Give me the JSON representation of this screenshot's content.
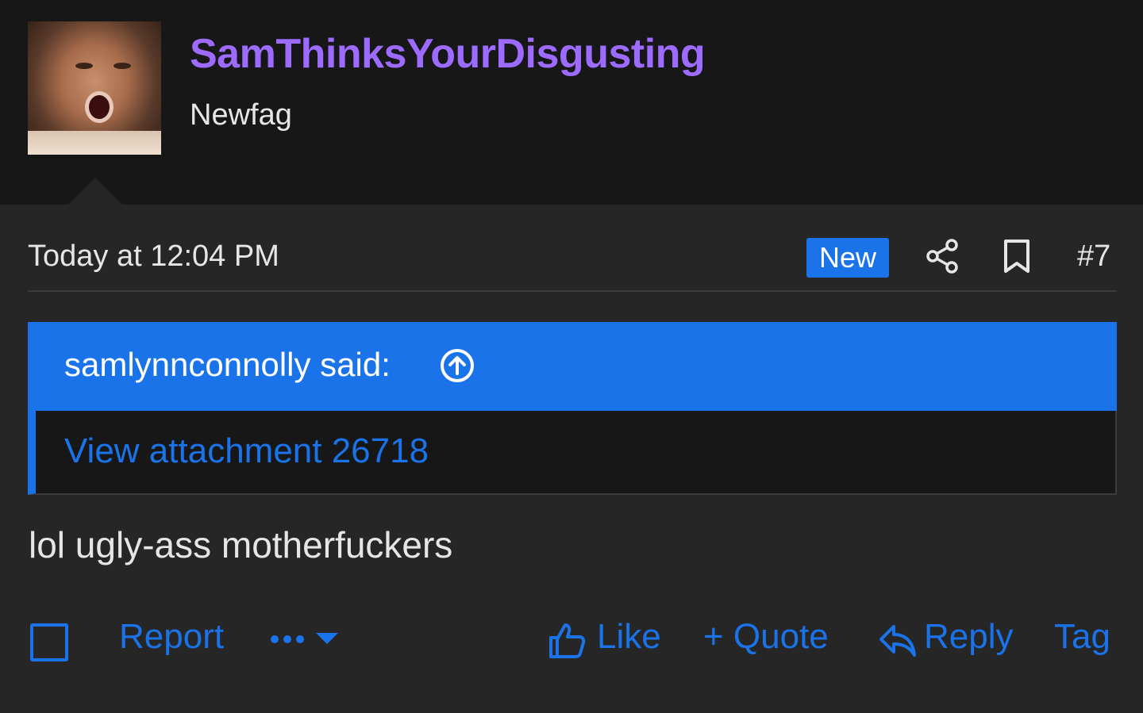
{
  "user": {
    "name": "SamThinksYourDisgusting",
    "title": "Newfag",
    "name_color": "#9d6bff"
  },
  "post": {
    "timestamp": "Today at 12:04 PM",
    "badge": "New",
    "number": "#7",
    "icons": [
      "share-icon",
      "bookmark-icon"
    ]
  },
  "quote": {
    "author": "samlynnconnolly said:",
    "link": "View attachment 26718",
    "icon": "arrow-up-circle-icon"
  },
  "message": "lol ugly-ass motherfuckers",
  "actions": {
    "report": "Report",
    "more": "•••",
    "like": "Like",
    "quote": "+ Quote",
    "reply": "Reply",
    "tag": "Tag"
  },
  "colors": {
    "accent": "#1a73e8",
    "background": "#262626",
    "header": "#171717"
  }
}
